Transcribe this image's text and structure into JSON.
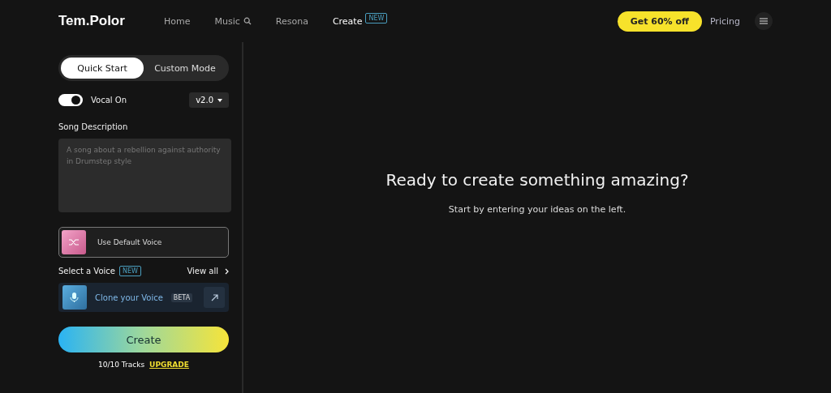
{
  "header": {
    "logo": "Tem.Polor",
    "nav": [
      {
        "label": "Home",
        "selected": false,
        "kind": "plain"
      },
      {
        "label": "Music",
        "selected": false,
        "kind": "search"
      },
      {
        "label": "Resona",
        "selected": false,
        "kind": "plain"
      },
      {
        "label": "Create",
        "selected": true,
        "kind": "badge",
        "badge": "NEW"
      }
    ],
    "promo": "Get 60% off",
    "pricing": "Pricing"
  },
  "panel": {
    "tabs": [
      {
        "label": "Quick Start",
        "selected": true
      },
      {
        "label": "Custom Mode",
        "selected": false
      }
    ],
    "vocal": {
      "label": "Vocal On",
      "on": true
    },
    "version": "v2.0",
    "description": {
      "label": "Song Description",
      "placeholder": "A song about a rebellion against authority in Drumstep style"
    },
    "default_voice": {
      "label": "Use Default Voice",
      "selected": true
    },
    "select_voice": {
      "label": "Select a Voice",
      "badge": "NEW",
      "view_all": "View all"
    },
    "clone": {
      "label": "Clone your Voice",
      "badge": "BETA"
    },
    "create": "Create",
    "tracks": "10/10 Tracks",
    "upgrade": "UPGRADE"
  },
  "main": {
    "title": "Ready to create something amazing?",
    "subtitle": "Start by entering your ideas on the left."
  }
}
